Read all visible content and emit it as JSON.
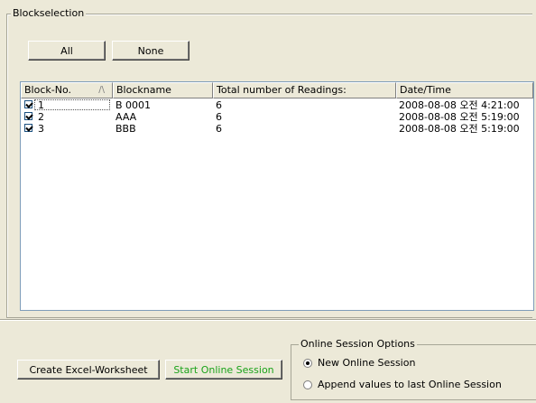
{
  "blockselection": {
    "title": "Blockselection",
    "all_label": "All",
    "none_label": "None"
  },
  "table": {
    "columns": [
      {
        "label": "Block-No.",
        "sort": "/\\"
      },
      {
        "label": "Blockname"
      },
      {
        "label": "Total number of Readings:"
      },
      {
        "label": "Date/Time"
      }
    ],
    "rows": [
      {
        "checked": true,
        "no": "1",
        "name": "B 0001",
        "readings": "6",
        "datetime": "2008-08-08 오전 4:21:00"
      },
      {
        "checked": true,
        "no": "2",
        "name": "AAA",
        "readings": "6",
        "datetime": "2008-08-08 오전 5:19:00"
      },
      {
        "checked": true,
        "no": "3",
        "name": "BBB",
        "readings": "6",
        "datetime": "2008-08-08 오전 5:19:00"
      }
    ]
  },
  "bottom": {
    "create_excel_label": "Create Excel-Worksheet",
    "start_online_label": "Start Online Session",
    "start_online_color": "#1aa31a",
    "options_title": "Online Session Options",
    "radio_new": "New Online Session",
    "radio_append": "Append values to last Online Session",
    "selected": "new"
  }
}
